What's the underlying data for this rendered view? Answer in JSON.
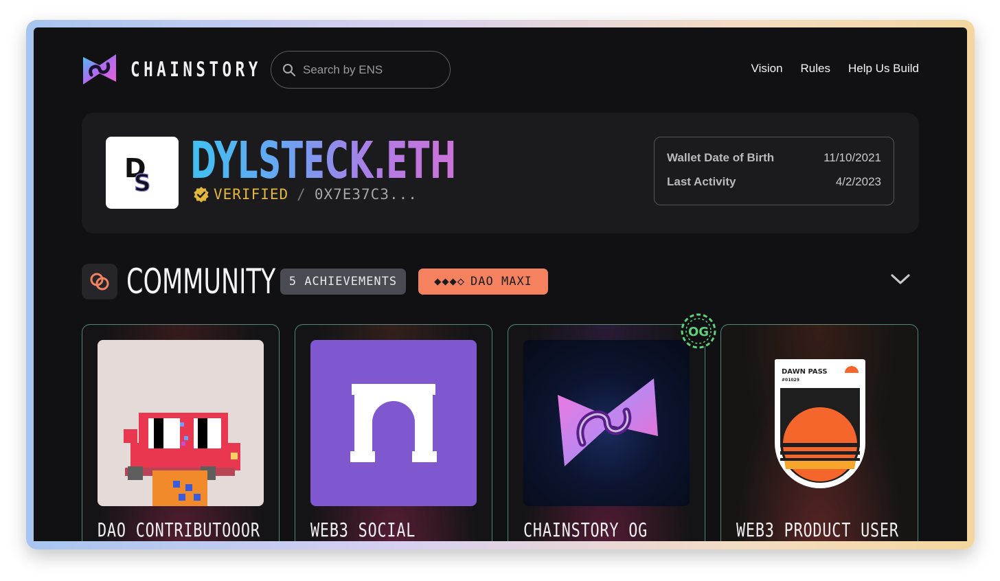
{
  "header": {
    "brand": "CHAINSTORY",
    "search_placeholder": "Search by ENS",
    "nav": [
      "Vision",
      "Rules",
      "Help Us Build"
    ]
  },
  "profile": {
    "avatar_initials": "DS",
    "ens_name": "DYLSTECK.ETH",
    "verified_label": "VERIFIED",
    "separator": "/",
    "address": "0X7E37C3...",
    "wallet_dob_label": "Wallet Date of Birth",
    "wallet_dob_value": "11/10/2021",
    "last_activity_label": "Last Activity",
    "last_activity_value": "4/2/2023"
  },
  "community": {
    "title": "COMMUNITY",
    "achievements_badge": "5 ACHIEVEMENTS",
    "dao_badge_diamonds": "◆◆◆◇",
    "dao_badge_label": "DAO MAXI",
    "og_badge": "OG"
  },
  "cards": [
    {
      "title": "DAO CONTRIBUTOOOR"
    },
    {
      "title": "WEB3 SOCIAL"
    },
    {
      "title": "CHAINSTORY OG"
    },
    {
      "title": "WEB3 PRODUCT USER",
      "pass_title": "DAWN PASS",
      "pass_number": "#01029"
    }
  ],
  "colors": {
    "background": "#111113",
    "dao_badge": "#f5825f",
    "verified": "#e3b73d",
    "card_border": "#74d6b9"
  }
}
